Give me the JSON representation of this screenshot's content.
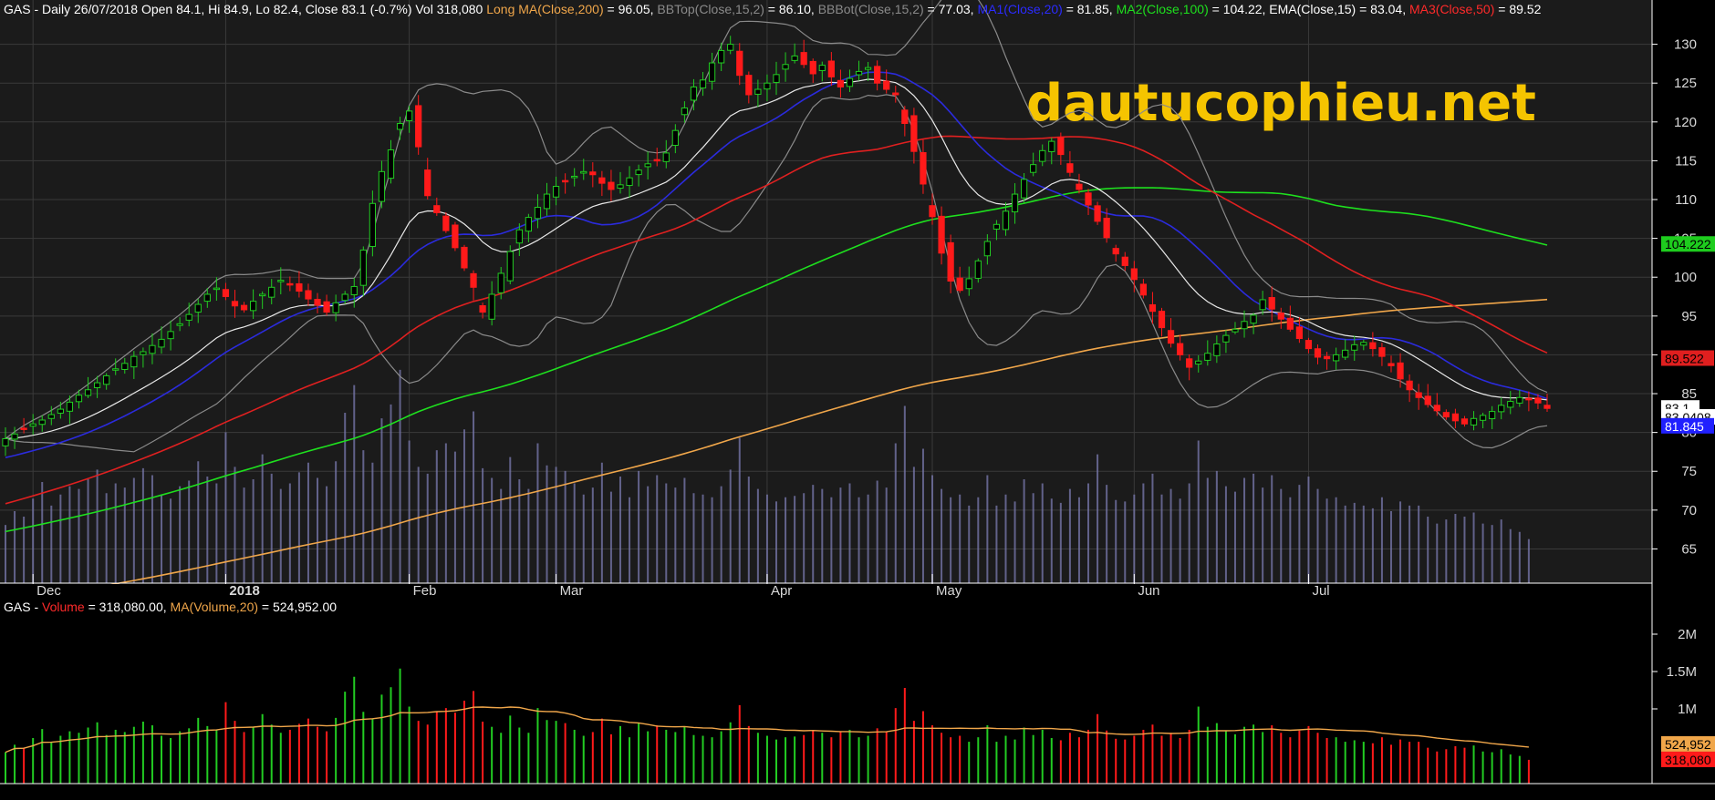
{
  "header": {
    "price": [
      {
        "text": "GAS - Daily 26/07/2018 Open 84.1, Hi 84.9, Lo 82.4, Close 83.1 (-0.7%) Vol 318,080 ",
        "color": "#ffffff"
      },
      {
        "text": "Long MA(Close,200)",
        "color": "#f0a64a"
      },
      {
        "text": " = 96.05, ",
        "color": "#ffffff"
      },
      {
        "text": "BBTop(Close,15,2)",
        "color": "#8a8a8a"
      },
      {
        "text": " = 86.10, ",
        "color": "#ffffff"
      },
      {
        "text": "BBBot(Close,15,2)",
        "color": "#8a8a8a"
      },
      {
        "text": " = 77.03, ",
        "color": "#ffffff"
      },
      {
        "text": "MA1(Close,20)",
        "color": "#2b2bff"
      },
      {
        "text": " = 81.85, ",
        "color": "#ffffff"
      },
      {
        "text": "MA2(Close,100)",
        "color": "#1ee01e"
      },
      {
        "text": " = 104.22, EMA(Close,15) = 83.04, ",
        "color": "#ffffff"
      },
      {
        "text": "MA3(Close,50)",
        "color": "#ff2a2a"
      },
      {
        "text": " = 89.52",
        "color": "#ffffff"
      }
    ],
    "volume": [
      {
        "text": "GAS - ",
        "color": "#ffffff"
      },
      {
        "text": "Volume",
        "color": "#ff2a2a"
      },
      {
        "text": " = 318,080.00, ",
        "color": "#ffffff"
      },
      {
        "text": "MA(Volume,20)",
        "color": "#f0a64a"
      },
      {
        "text": " = 524,952.00",
        "color": "#ffffff"
      }
    ]
  },
  "watermark": "dautucophieu.net",
  "colors": {
    "background": "#000000",
    "pricePanel": "#1b1b1b",
    "volumePanel": "#000000",
    "up": "#22cc22",
    "down": "#ff1a1a",
    "ma200": "#f0a64a",
    "ma100": "#1ee01e",
    "ma50": "#e02020",
    "ma20": "#2b2bdd",
    "ema15": "#e8e8e8",
    "bb": "#8a8a8a",
    "overlayVolume": "#7a7ab0",
    "volumeMA": "#f0a64a",
    "grid": "#3a3a3a"
  },
  "chart_data": [
    {
      "type": "candlestick",
      "symbol": "GAS",
      "ylim": [
        62,
        135
      ],
      "yticks": [
        65,
        70,
        75,
        80,
        85,
        90,
        95,
        100,
        105,
        110,
        115,
        120,
        125,
        130
      ],
      "months": [
        {
          "label": "Dec",
          "index": 3
        },
        {
          "label": "2018",
          "index": 24
        },
        {
          "label": "Feb",
          "index": 44
        },
        {
          "label": "Mar",
          "index": 60
        },
        {
          "label": "Apr",
          "index": 83
        },
        {
          "label": "May",
          "index": 101
        },
        {
          "label": "Jun",
          "index": 123
        },
        {
          "label": "Jul",
          "index": 142
        }
      ],
      "close": [
        79.2,
        79.8,
        80.5,
        81.1,
        81.6,
        82.3,
        83.0,
        83.9,
        84.8,
        85.5,
        86.4,
        87.3,
        88.2,
        88.9,
        89.8,
        90.4,
        91.2,
        92.0,
        93.0,
        94.0,
        95.2,
        96.5,
        97.8,
        98.6,
        97.5,
        96.3,
        95.8,
        96.9,
        97.8,
        98.7,
        99.6,
        99.1,
        98.2,
        97.2,
        96.4,
        95.5,
        96.7,
        97.8,
        98.8,
        103.5,
        109.5,
        113.6,
        116.4,
        119.8,
        121.4,
        116.8,
        110.5,
        108.3,
        106.0,
        103.8,
        101.2,
        98.7,
        95.5,
        97.8,
        100.5,
        103.3,
        106.1,
        107.7,
        109.0,
        110.7,
        111.7,
        112.4,
        113.0,
        113.6,
        113.2,
        112.1,
        111.3,
        111.9,
        112.8,
        113.8,
        114.6,
        115.1,
        116.0,
        118.9,
        121.8,
        124.5,
        125.4,
        127.6,
        129.2,
        130.0,
        126.0,
        123.5,
        124.2,
        125.0,
        126.1,
        127.4,
        128.5,
        127.4,
        126.2,
        127.3,
        125.8,
        124.5,
        125.6,
        126.5,
        127.0,
        125.0,
        124.2,
        123.5,
        119.8,
        116.2,
        112.0,
        107.8,
        103.1,
        99.5,
        98.3,
        99.8,
        102.1,
        104.6,
        106.8,
        108.5,
        110.7,
        112.6,
        114.5,
        116.3,
        117.5,
        115.8,
        113.5,
        111.3,
        109.3,
        107.2,
        105.1,
        103.0,
        101.5,
        99.7,
        97.7,
        95.6,
        93.5,
        91.5,
        90.0,
        88.4,
        89.2,
        90.2,
        91.4,
        92.5,
        93.3,
        94.3,
        95.1,
        97.1,
        95.9,
        94.6,
        93.3,
        92.1,
        90.8,
        89.7,
        89.5,
        90.0,
        90.6,
        91.3,
        91.6,
        90.8,
        89.8,
        88.6,
        86.9,
        85.5,
        84.5,
        83.6,
        82.8,
        82.0,
        81.5,
        81.1,
        81.8,
        82.2,
        82.7,
        83.5,
        84.0,
        84.5,
        84.2,
        83.8,
        83.1
      ]
    },
    {
      "type": "bar",
      "name": "Volume",
      "ylim": [
        0,
        2500000
      ],
      "yticks": [
        {
          "value": 1000000,
          "label": "1M"
        },
        {
          "value": 1500000,
          "label": "1.5M"
        },
        {
          "value": 2000000,
          "label": "2M"
        }
      ],
      "values": [
        420000,
        520000,
        480000,
        610000,
        730000,
        560000,
        640000,
        700000,
        680000,
        750000,
        820000,
        650000,
        720000,
        690000,
        760000,
        830000,
        780000,
        640000,
        610000,
        700000,
        740000,
        880000,
        770000,
        720000,
        1090000,
        840000,
        690000,
        750000,
        930000,
        790000,
        680000,
        720000,
        800000,
        870000,
        760000,
        700000,
        880000,
        1230000,
        1430000,
        960000,
        870000,
        1190000,
        1290000,
        1540000,
        1030000,
        840000,
        790000,
        960000,
        1010000,
        950000,
        1110000,
        1240000,
        830000,
        760000,
        680000,
        910000,
        750000,
        680000,
        1010000,
        850000,
        840000,
        810000,
        720000,
        640000,
        690000,
        870000,
        660000,
        770000,
        620000,
        810000,
        700000,
        780000,
        720000,
        690000,
        760000,
        650000,
        640000,
        620000,
        700000,
        820000,
        1050000,
        770000,
        680000,
        640000,
        590000,
        620000,
        630000,
        650000,
        710000,
        680000,
        620000,
        690000,
        720000,
        620000,
        640000,
        740000,
        690000,
        1010000,
        1280000,
        840000,
        970000,
        780000,
        680000,
        620000,
        640000,
        560000,
        620000,
        780000,
        560000,
        640000,
        590000,
        750000,
        650000,
        720000,
        610000,
        580000,
        680000,
        620000,
        720000,
        930000,
        710000,
        600000,
        590000,
        640000,
        720000,
        790000,
        640000,
        680000,
        610000,
        720000,
        1030000,
        760000,
        810000,
        700000,
        660000,
        760000,
        790000,
        690000,
        780000,
        680000,
        620000,
        710000,
        770000,
        680000,
        610000,
        620000,
        560000,
        580000,
        560000,
        540000,
        620000,
        520000,
        590000,
        560000,
        560000,
        480000,
        430000,
        460000,
        500000,
        480000,
        510000,
        430000,
        420000,
        460000,
        390000,
        370000,
        318080
      ]
    }
  ],
  "axisTags": {
    "price": [
      {
        "label": "104.222",
        "value": 104.222,
        "bg": "#1ecc1e",
        "fg": "#000000"
      },
      {
        "label": "89.522",
        "value": 89.522,
        "bg": "#e01f1f",
        "fg": "#000000"
      },
      {
        "label": "83.1",
        "value": 83.1,
        "bg": "#ffffff",
        "fg": "#000000"
      },
      {
        "label": "83.0408",
        "value": 81.95,
        "bg": "#ffffff",
        "fg": "#000000"
      },
      {
        "label": "81.845",
        "value": 80.8,
        "bg": "#2020ff",
        "fg": "#ffffff"
      }
    ],
    "volume": [
      {
        "label": "524,952",
        "value": 524952,
        "bg": "#f0a64a",
        "fg": "#000000"
      },
      {
        "label": "318,080",
        "value": 318080,
        "bg": "#ff1a1a",
        "fg": "#000000"
      }
    ]
  }
}
